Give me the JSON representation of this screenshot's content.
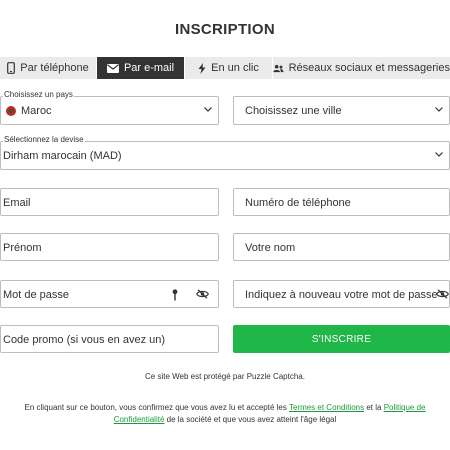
{
  "header": {
    "title": "INSCRIPTION"
  },
  "tabs": [
    {
      "label": "Par téléphone",
      "icon": "phone-icon"
    },
    {
      "label": "Par e-mail",
      "icon": "envelope-icon",
      "active": true
    },
    {
      "label": "En un clic",
      "icon": "lightning-icon"
    },
    {
      "label": "Réseaux sociaux et messageries",
      "icon": "users-icon"
    }
  ],
  "form": {
    "country": {
      "label": "Choisissez un pays",
      "value": "Maroc",
      "flag_color": "#c1272d"
    },
    "city": {
      "placeholder": "Choisissez une ville"
    },
    "currency": {
      "label": "Sélectionnez la devise",
      "value": "Dirham marocain (MAD)"
    },
    "email": {
      "placeholder": "Email"
    },
    "phone": {
      "placeholder": "Numéro de téléphone"
    },
    "first_name": {
      "placeholder": "Prénom"
    },
    "last_name": {
      "placeholder": "Votre nom"
    },
    "password": {
      "placeholder": "Mot de passe"
    },
    "password_confirm": {
      "placeholder": "Indiquez à nouveau votre mot de passe"
    },
    "promo": {
      "placeholder": "Code promo (si vous en avez un)"
    },
    "register_label": "S'INSCRIRE"
  },
  "footer": {
    "captcha_text": "Ce site Web est protégé par Puzzle Captcha.",
    "legal_part1": "En cliquant sur ce bouton, vous confirmez que vous avez lu et accepté les ",
    "terms_link": "Termes et Conditions",
    "legal_part2": " et la ",
    "privacy_link": "Politique de Confidentialité",
    "legal_part3": " de la société et que vous avez atteint l'âge légal"
  },
  "colors": {
    "accent_green": "#1fb848",
    "link_green": "#1b9a3c",
    "tab_active": "#333333",
    "tab_bg": "#ebebeb"
  }
}
